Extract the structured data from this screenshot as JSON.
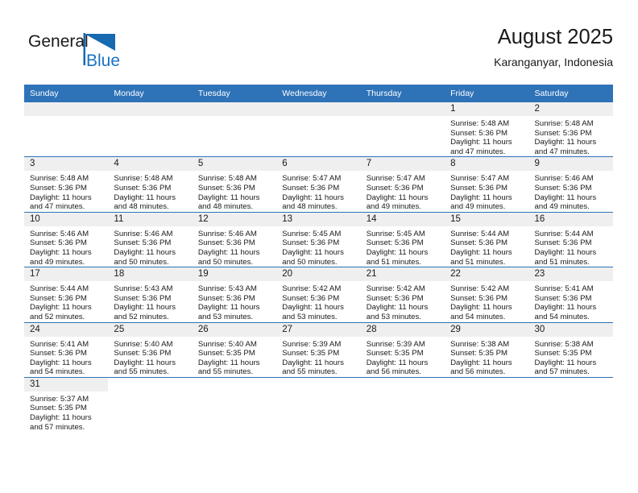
{
  "brand": {
    "name_part1": "General",
    "name_part2": "Blue",
    "icon": "triangle-flag-icon"
  },
  "header": {
    "title": "August 2025",
    "subtitle": "Karanganyar, Indonesia"
  },
  "colors": {
    "header_blue": "#2e72b8",
    "daynum_band": "#efefef",
    "text": "#1a1a1a",
    "brand_blue": "#1a72c4"
  },
  "weekday_headers": [
    "Sunday",
    "Monday",
    "Tuesday",
    "Wednesday",
    "Thursday",
    "Friday",
    "Saturday"
  ],
  "labels": {
    "sunrise_prefix": "Sunrise:",
    "sunset_prefix": "Sunset:",
    "daylight_prefix": "Daylight:"
  },
  "weeks": [
    [
      {
        "blank": true
      },
      {
        "blank": true
      },
      {
        "blank": true
      },
      {
        "blank": true
      },
      {
        "blank": true
      },
      {
        "day": "1",
        "sunrise": "Sunrise: 5:48 AM",
        "sunset": "Sunset: 5:36 PM",
        "daylight1": "Daylight: 11 hours",
        "daylight2": "and 47 minutes."
      },
      {
        "day": "2",
        "sunrise": "Sunrise: 5:48 AM",
        "sunset": "Sunset: 5:36 PM",
        "daylight1": "Daylight: 11 hours",
        "daylight2": "and 47 minutes."
      }
    ],
    [
      {
        "day": "3",
        "sunrise": "Sunrise: 5:48 AM",
        "sunset": "Sunset: 5:36 PM",
        "daylight1": "Daylight: 11 hours",
        "daylight2": "and 47 minutes."
      },
      {
        "day": "4",
        "sunrise": "Sunrise: 5:48 AM",
        "sunset": "Sunset: 5:36 PM",
        "daylight1": "Daylight: 11 hours",
        "daylight2": "and 48 minutes."
      },
      {
        "day": "5",
        "sunrise": "Sunrise: 5:48 AM",
        "sunset": "Sunset: 5:36 PM",
        "daylight1": "Daylight: 11 hours",
        "daylight2": "and 48 minutes."
      },
      {
        "day": "6",
        "sunrise": "Sunrise: 5:47 AM",
        "sunset": "Sunset: 5:36 PM",
        "daylight1": "Daylight: 11 hours",
        "daylight2": "and 48 minutes."
      },
      {
        "day": "7",
        "sunrise": "Sunrise: 5:47 AM",
        "sunset": "Sunset: 5:36 PM",
        "daylight1": "Daylight: 11 hours",
        "daylight2": "and 49 minutes."
      },
      {
        "day": "8",
        "sunrise": "Sunrise: 5:47 AM",
        "sunset": "Sunset: 5:36 PM",
        "daylight1": "Daylight: 11 hours",
        "daylight2": "and 49 minutes."
      },
      {
        "day": "9",
        "sunrise": "Sunrise: 5:46 AM",
        "sunset": "Sunset: 5:36 PM",
        "daylight1": "Daylight: 11 hours",
        "daylight2": "and 49 minutes."
      }
    ],
    [
      {
        "day": "10",
        "sunrise": "Sunrise: 5:46 AM",
        "sunset": "Sunset: 5:36 PM",
        "daylight1": "Daylight: 11 hours",
        "daylight2": "and 49 minutes."
      },
      {
        "day": "11",
        "sunrise": "Sunrise: 5:46 AM",
        "sunset": "Sunset: 5:36 PM",
        "daylight1": "Daylight: 11 hours",
        "daylight2": "and 50 minutes."
      },
      {
        "day": "12",
        "sunrise": "Sunrise: 5:46 AM",
        "sunset": "Sunset: 5:36 PM",
        "daylight1": "Daylight: 11 hours",
        "daylight2": "and 50 minutes."
      },
      {
        "day": "13",
        "sunrise": "Sunrise: 5:45 AM",
        "sunset": "Sunset: 5:36 PM",
        "daylight1": "Daylight: 11 hours",
        "daylight2": "and 50 minutes."
      },
      {
        "day": "14",
        "sunrise": "Sunrise: 5:45 AM",
        "sunset": "Sunset: 5:36 PM",
        "daylight1": "Daylight: 11 hours",
        "daylight2": "and 51 minutes."
      },
      {
        "day": "15",
        "sunrise": "Sunrise: 5:44 AM",
        "sunset": "Sunset: 5:36 PM",
        "daylight1": "Daylight: 11 hours",
        "daylight2": "and 51 minutes."
      },
      {
        "day": "16",
        "sunrise": "Sunrise: 5:44 AM",
        "sunset": "Sunset: 5:36 PM",
        "daylight1": "Daylight: 11 hours",
        "daylight2": "and 51 minutes."
      }
    ],
    [
      {
        "day": "17",
        "sunrise": "Sunrise: 5:44 AM",
        "sunset": "Sunset: 5:36 PM",
        "daylight1": "Daylight: 11 hours",
        "daylight2": "and 52 minutes."
      },
      {
        "day": "18",
        "sunrise": "Sunrise: 5:43 AM",
        "sunset": "Sunset: 5:36 PM",
        "daylight1": "Daylight: 11 hours",
        "daylight2": "and 52 minutes."
      },
      {
        "day": "19",
        "sunrise": "Sunrise: 5:43 AM",
        "sunset": "Sunset: 5:36 PM",
        "daylight1": "Daylight: 11 hours",
        "daylight2": "and 53 minutes."
      },
      {
        "day": "20",
        "sunrise": "Sunrise: 5:42 AM",
        "sunset": "Sunset: 5:36 PM",
        "daylight1": "Daylight: 11 hours",
        "daylight2": "and 53 minutes."
      },
      {
        "day": "21",
        "sunrise": "Sunrise: 5:42 AM",
        "sunset": "Sunset: 5:36 PM",
        "daylight1": "Daylight: 11 hours",
        "daylight2": "and 53 minutes."
      },
      {
        "day": "22",
        "sunrise": "Sunrise: 5:42 AM",
        "sunset": "Sunset: 5:36 PM",
        "daylight1": "Daylight: 11 hours",
        "daylight2": "and 54 minutes."
      },
      {
        "day": "23",
        "sunrise": "Sunrise: 5:41 AM",
        "sunset": "Sunset: 5:36 PM",
        "daylight1": "Daylight: 11 hours",
        "daylight2": "and 54 minutes."
      }
    ],
    [
      {
        "day": "24",
        "sunrise": "Sunrise: 5:41 AM",
        "sunset": "Sunset: 5:36 PM",
        "daylight1": "Daylight: 11 hours",
        "daylight2": "and 54 minutes."
      },
      {
        "day": "25",
        "sunrise": "Sunrise: 5:40 AM",
        "sunset": "Sunset: 5:36 PM",
        "daylight1": "Daylight: 11 hours",
        "daylight2": "and 55 minutes."
      },
      {
        "day": "26",
        "sunrise": "Sunrise: 5:40 AM",
        "sunset": "Sunset: 5:35 PM",
        "daylight1": "Daylight: 11 hours",
        "daylight2": "and 55 minutes."
      },
      {
        "day": "27",
        "sunrise": "Sunrise: 5:39 AM",
        "sunset": "Sunset: 5:35 PM",
        "daylight1": "Daylight: 11 hours",
        "daylight2": "and 55 minutes."
      },
      {
        "day": "28",
        "sunrise": "Sunrise: 5:39 AM",
        "sunset": "Sunset: 5:35 PM",
        "daylight1": "Daylight: 11 hours",
        "daylight2": "and 56 minutes."
      },
      {
        "day": "29",
        "sunrise": "Sunrise: 5:38 AM",
        "sunset": "Sunset: 5:35 PM",
        "daylight1": "Daylight: 11 hours",
        "daylight2": "and 56 minutes."
      },
      {
        "day": "30",
        "sunrise": "Sunrise: 5:38 AM",
        "sunset": "Sunset: 5:35 PM",
        "daylight1": "Daylight: 11 hours",
        "daylight2": "and 57 minutes."
      }
    ],
    [
      {
        "day": "31",
        "sunrise": "Sunrise: 5:37 AM",
        "sunset": "Sunset: 5:35 PM",
        "daylight1": "Daylight: 11 hours",
        "daylight2": "and 57 minutes."
      },
      {
        "blank": true
      },
      {
        "blank": true
      },
      {
        "blank": true
      },
      {
        "blank": true
      },
      {
        "blank": true
      },
      {
        "blank": true
      }
    ]
  ]
}
